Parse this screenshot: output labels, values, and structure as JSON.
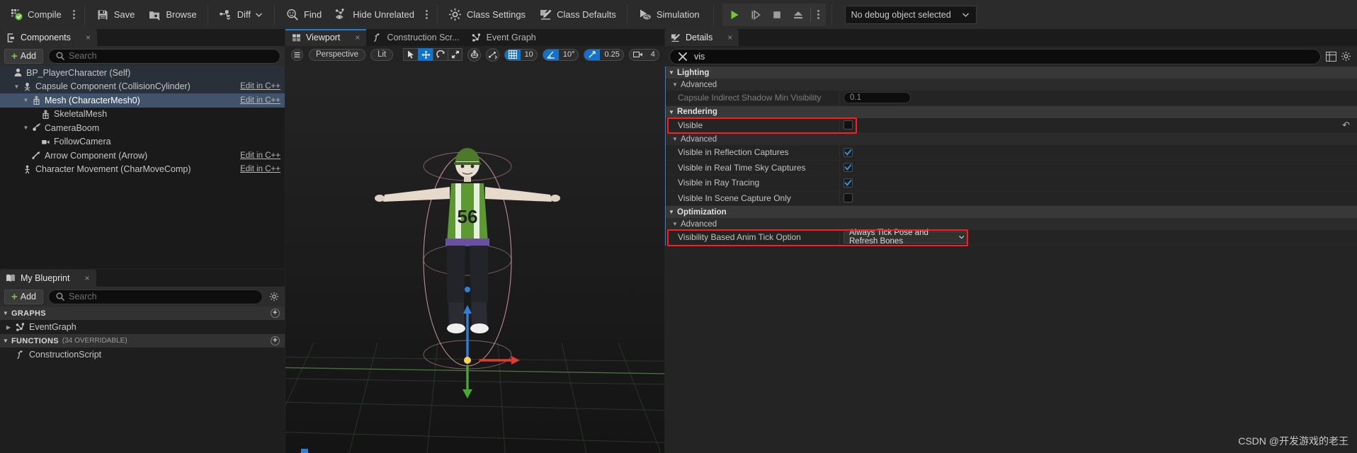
{
  "toolbar": {
    "compile": "Compile",
    "save": "Save",
    "browse": "Browse",
    "diff": "Diff",
    "find": "Find",
    "hide_unrelated": "Hide Unrelated",
    "class_settings": "Class Settings",
    "class_defaults": "Class Defaults",
    "simulation": "Simulation",
    "debug_object": "No debug object selected"
  },
  "components_panel": {
    "tab": "Components",
    "close": "×",
    "add": "Add",
    "search_placeholder": "Search",
    "search_value": "",
    "tree": [
      {
        "label": "BP_PlayerCharacter (Self)",
        "indent": 0,
        "icon": "character-icon",
        "arrow": "",
        "cpp": "",
        "state": "root"
      },
      {
        "label": "Capsule Component (CollisionCylinder)",
        "indent": 1,
        "icon": "capsule-icon",
        "arrow": "▼",
        "cpp": "Edit in C++",
        "state": "root"
      },
      {
        "label": "Mesh (CharacterMesh0)",
        "indent": 2,
        "icon": "skeletal-mesh-icon",
        "arrow": "▼",
        "cpp": "Edit in C++",
        "state": "selected"
      },
      {
        "label": "SkeletalMesh",
        "indent": 3,
        "icon": "skeletal-mesh-icon",
        "arrow": "",
        "cpp": "",
        "state": ""
      },
      {
        "label": "CameraBoom",
        "indent": 2,
        "icon": "spring-arm-icon",
        "arrow": "▼",
        "cpp": "",
        "state": ""
      },
      {
        "label": "FollowCamera",
        "indent": 3,
        "icon": "camera-icon",
        "arrow": "",
        "cpp": "",
        "state": ""
      },
      {
        "label": "Arrow Component (Arrow)",
        "indent": 2,
        "icon": "arrow-component-icon",
        "arrow": "",
        "cpp": "Edit in C++",
        "state": ""
      },
      {
        "label": "Character Movement (CharMoveComp)",
        "indent": 1,
        "icon": "movement-icon",
        "arrow": "",
        "cpp": "Edit in C++",
        "state": ""
      }
    ]
  },
  "my_blueprint_panel": {
    "tab": "My Blueprint",
    "close": "×",
    "add": "Add",
    "search_placeholder": "Search",
    "search_value": "",
    "sections": [
      {
        "title": "GRAPHS",
        "sub": "",
        "items": [
          {
            "label": "EventGraph",
            "icon": "event-graph-icon",
            "arrow": "▶"
          }
        ]
      },
      {
        "title": "FUNCTIONS",
        "sub": "(34 OVERRIDABLE)",
        "items": [
          {
            "label": "ConstructionScript",
            "icon": "function-icon",
            "arrow": ""
          }
        ]
      }
    ]
  },
  "viewport_panel": {
    "tabs": [
      {
        "label": "Viewport",
        "icon": "viewport-icon",
        "active": true,
        "close": "×"
      },
      {
        "label": "Construction Scr...",
        "icon": "function-icon",
        "active": false,
        "close": ""
      },
      {
        "label": "Event Graph",
        "icon": "event-graph-icon",
        "active": false,
        "close": ""
      }
    ],
    "toolbar": {
      "menu_icon": "hamburger-icon",
      "camera_mode": "Perspective",
      "view_mode": "Lit",
      "transform_tools": [
        "select-icon",
        "move-icon",
        "rotate-icon",
        "scale-icon"
      ],
      "coord_icon": "world-coordinate-icon",
      "snap_icon": "surface-snap-icon",
      "grid_snap_value": "10",
      "rotation_snap_value": "10°",
      "scale_snap_value": "0.25",
      "camera_speed_value": "4"
    }
  },
  "details_panel": {
    "tab": "Details",
    "close": "×",
    "search_value": "vis",
    "search_placeholder": "Search",
    "clear_icon": "clear-x-icon",
    "grid_view_icon": "grid-view-icon",
    "settings_icon": "gear-icon",
    "rows": [
      {
        "type": "category",
        "label": "Lighting"
      },
      {
        "type": "subcategory",
        "label": "Advanced"
      },
      {
        "type": "prop",
        "label": "Capsule Indirect Shadow Min Visibility",
        "control": "number",
        "value": "0.1",
        "disabled": true
      },
      {
        "type": "category",
        "label": "Rendering"
      },
      {
        "type": "prop",
        "label": "Visible",
        "control": "checkbox",
        "value": false,
        "highlight": true,
        "revert": "↶"
      },
      {
        "type": "subcategory",
        "label": "Advanced"
      },
      {
        "type": "prop",
        "label": "Visible in Reflection Captures",
        "control": "checkbox",
        "value": true
      },
      {
        "type": "prop",
        "label": "Visible in Real Time Sky Captures",
        "control": "checkbox",
        "value": true
      },
      {
        "type": "prop",
        "label": "Visible in Ray Tracing",
        "control": "checkbox",
        "value": true
      },
      {
        "type": "prop",
        "label": "Visible In Scene Capture Only",
        "control": "checkbox",
        "value": false
      },
      {
        "type": "category",
        "label": "Optimization"
      },
      {
        "type": "subcategory",
        "label": "Advanced"
      },
      {
        "type": "prop",
        "label": "Visibility Based Anim Tick Option",
        "control": "combo",
        "value": "Always Tick Pose and Refresh Bones",
        "highlight": true
      }
    ]
  },
  "watermark": "CSDN @开发游戏的老王",
  "colors": {
    "accent_blue": "#1273cf",
    "selection_blue": "#41536b",
    "highlight_red": "#ff1d1d",
    "green": "#7ec64a",
    "panel_bg": "#1e1e1e"
  }
}
